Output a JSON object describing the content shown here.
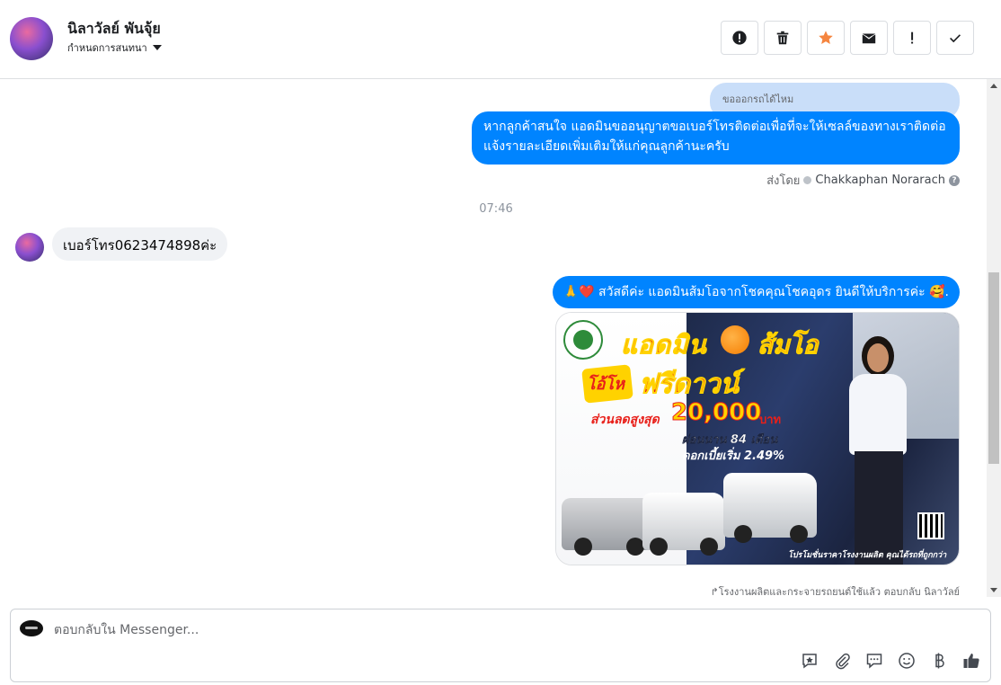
{
  "header": {
    "contact_name": "นิลาวัลย์ พันจุ้ย",
    "assign_label": "กำหนดการสนทนา",
    "toolbar": [
      {
        "name": "mark-spam-button",
        "icon": "alert-circle-icon"
      },
      {
        "name": "delete-button",
        "icon": "trash-icon"
      },
      {
        "name": "star-button",
        "icon": "star-icon"
      },
      {
        "name": "move-to-inbox-button",
        "icon": "inbox-icon"
      },
      {
        "name": "follow-up-button",
        "icon": "exclamation-icon"
      },
      {
        "name": "mark-done-button",
        "icon": "check-icon"
      }
    ]
  },
  "messages": {
    "reply_preview": "ขอออกรถได้ไหม",
    "outgoing_1": "หากลูกค้าสนใจ แอดมินขออนุญาตขอเบอร์โทรติดต่อเพื่อที่จะให้เซลล์ของทางเราติดต่อแจ้งรายละเอียดเพิ่มเติมให้แก่คุณลูกค้านะครับ",
    "sent_by_label": "ส่งโดย",
    "sent_by_agent": "Chakkaphan Norarach",
    "timestamp": "07:46",
    "incoming_1": "เบอร์โทร0623474898ค่ะ",
    "outgoing_2": "🙏❤️ สวัสดีค่ะ แอดมินส้มโอจากโชคคุณโชคอุดร ยินดีให้บริการค่ะ 🥰.",
    "promo_image": {
      "title_left": "แอดมิน",
      "title_right": "ส้มโอ",
      "give": "โอ้โห",
      "free_down": "ฟรีดาวน์",
      "discount_label": "ส่วนลดสูงสุด",
      "discount_value": "20,000",
      "discount_unit": "บาท",
      "installment": "ผ่อนนาน 84 เดือน",
      "interest": "ดอกเบี้ยเริ่ม 2.49%",
      "footer": "โปรโมชั่นราคาโรงงานผลิต คุณได้รถที่ถูกกว่า"
    },
    "caption": "โรงงานผลิตและกระจายรถยนต์ใช้แล้ว ตอบกลับ นิลาวัลย์"
  },
  "composer": {
    "placeholder": "ตอบกลับใน Messenger...",
    "tools": [
      "saved-reply-icon",
      "attachment-icon",
      "quick-reply-icon",
      "emoji-icon",
      "baht-icon",
      "like-icon"
    ]
  },
  "colors": {
    "outgoing_bubble": "#0084ff",
    "incoming_bubble": "#f0f2f5",
    "reply_pill": "#c9def9",
    "star": "#f5853f"
  }
}
